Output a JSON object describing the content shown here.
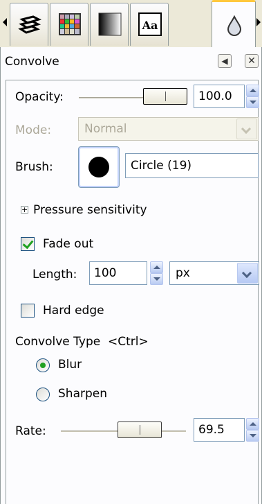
{
  "tabs": [
    {
      "icon": "layers-icon"
    },
    {
      "icon": "palette-grid-icon"
    },
    {
      "icon": "gradient-icon"
    },
    {
      "icon": "font-icon",
      "glyph": "Aa"
    },
    {
      "icon": "tool-drop-icon"
    }
  ],
  "panel": {
    "title": "Convolve",
    "menu_icon": "panel-menu-icon",
    "close_icon": "panel-close-icon"
  },
  "opacity": {
    "label": "Opacity:",
    "value": "100.0",
    "fraction": 1.0
  },
  "mode": {
    "label": "Mode:",
    "value": "Normal"
  },
  "brush": {
    "label": "Brush:",
    "name": "Circle (19)"
  },
  "pressure": {
    "expander_glyph": "+",
    "label": "Pressure sensitivity"
  },
  "fade_out": {
    "label": "Fade out",
    "checked": true
  },
  "length": {
    "label": "Length:",
    "value": "100",
    "unit": "px"
  },
  "hard_edge": {
    "label": "Hard edge",
    "checked": false
  },
  "convolve_type": {
    "label": "Convolve Type  <Ctrl>",
    "options": [
      {
        "label": "Blur",
        "selected": true
      },
      {
        "label": "Sharpen",
        "selected": false
      }
    ]
  },
  "rate": {
    "label": "Rate:",
    "value": "69.5",
    "fraction": 0.695
  },
  "colors": {
    "accent_tab": "#ffc83c",
    "check_green": "#21a121",
    "field_border": "#7f9db9"
  }
}
